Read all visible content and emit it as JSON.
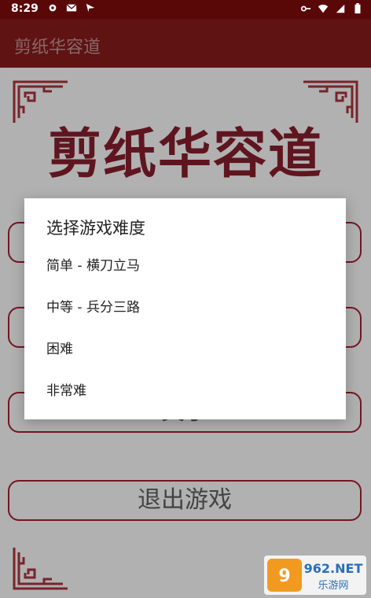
{
  "status_bar": {
    "time": "8:29"
  },
  "app_bar": {
    "title": "剪纸华容道"
  },
  "main": {
    "game_title": "剪纸华容道",
    "buttons": [
      {
        "label": ""
      },
      {
        "label": ""
      },
      {
        "label": "关于"
      },
      {
        "label": "退出游戏"
      }
    ]
  },
  "dialog": {
    "title": "选择游戏难度",
    "options": [
      {
        "label": "简单 - 横刀立马"
      },
      {
        "label": "中等 - 兵分三路"
      },
      {
        "label": "困难"
      },
      {
        "label": "非常难"
      }
    ]
  },
  "watermark": {
    "brand": "962.NET",
    "subtitle": "乐游网"
  },
  "colors": {
    "status_bar": "#5a0707",
    "app_bar": "#7f1a1a",
    "title_red": "#7f1c2a",
    "button_border": "#9a1f2c"
  }
}
